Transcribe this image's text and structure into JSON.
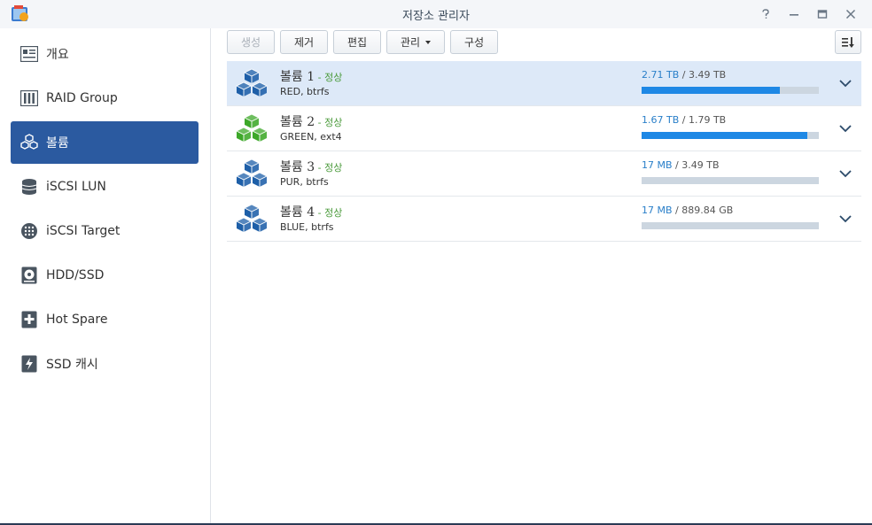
{
  "window": {
    "title": "저장소 관리자",
    "controls": [
      "help-icon",
      "minimize-icon",
      "maximize-icon",
      "close-icon"
    ]
  },
  "sidebar": {
    "items": [
      {
        "label": "개요",
        "icon": "overview-icon",
        "active": false
      },
      {
        "label": "RAID Group",
        "icon": "raid-group-icon",
        "active": false
      },
      {
        "label": "볼륨",
        "icon": "volume-icon",
        "active": true
      },
      {
        "label": "iSCSI LUN",
        "icon": "iscsi-lun-icon",
        "active": false
      },
      {
        "label": "iSCSI Target",
        "icon": "iscsi-target-icon",
        "active": false
      },
      {
        "label": "HDD/SSD",
        "icon": "hdd-ssd-icon",
        "active": false
      },
      {
        "label": "Hot Spare",
        "icon": "hot-spare-icon",
        "active": false
      },
      {
        "label": "SSD 캐시",
        "icon": "ssd-cache-icon",
        "active": false
      }
    ]
  },
  "toolbar": {
    "create_label": "생성",
    "remove_label": "제거",
    "edit_label": "편집",
    "manage_label": "관리",
    "configure_label": "구성",
    "sort_icon": "sort-icon"
  },
  "volumes": [
    {
      "name": "볼륨",
      "num": "1",
      "status": "정상",
      "sep": " - ",
      "sub": "RED, btrfs",
      "used": "2.71 TB",
      "total": "3.49 TB",
      "fill": 0.78,
      "color": "#1e5fa8",
      "selected": true
    },
    {
      "name": "볼륨",
      "num": "2",
      "status": "정상",
      "sep": " - ",
      "sub": "GREEN, ext4",
      "used": "1.67 TB",
      "total": "1.79 TB",
      "fill": 0.935,
      "color": "#3da829",
      "selected": false
    },
    {
      "name": "볼륨",
      "num": "3",
      "status": "정상",
      "sep": " - ",
      "sub": "PUR, btrfs",
      "used": "17 MB",
      "total": "3.49 TB",
      "fill": 0.0,
      "color": "#1e5fa8",
      "selected": false
    },
    {
      "name": "볼륨",
      "num": "4",
      "status": "정상",
      "sep": " - ",
      "sub": "BLUE, btrfs",
      "used": "17 MB",
      "total": "889.84 GB",
      "fill": 0.0,
      "color": "#1e5fa8",
      "selected": false
    }
  ],
  "usage_separator": " / "
}
